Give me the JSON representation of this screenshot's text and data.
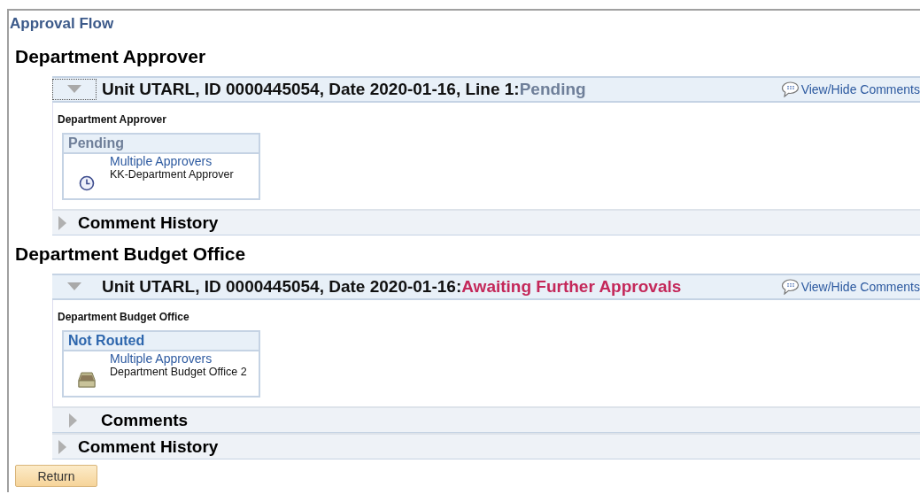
{
  "title": "Approval Flow",
  "sections": [
    {
      "heading": "Department Approver",
      "line": {
        "expanded": true,
        "focused": true,
        "label": "Unit UTARL, ID 0000445054, Date 2020-01-16, Line 1:",
        "status": "Pending",
        "color": "#6f7f99",
        "comments_link": "View/Hide Comments"
      },
      "step_label": "Department Approver",
      "approver": {
        "status": "Pending",
        "color": "#6f7f99",
        "link": "Multiple Approvers",
        "name": "KK-Department Approver",
        "kind": "clock"
      },
      "subpanels": [
        {
          "kind": "history",
          "label": "Comment History",
          "expanded": false
        }
      ]
    },
    {
      "heading": "Department Budget Office",
      "line": {
        "expanded": true,
        "focused": false,
        "label": "Unit UTARL, ID 0000445054, Date 2020-01-16:",
        "status": "Awaiting Further Approvals",
        "color": "#c4285a",
        "comments_link": "View/Hide Comments"
      },
      "step_label": "Department Budget Office",
      "approver": {
        "status": "Not Routed",
        "color": "#2d66ad",
        "link": "Multiple Approvers",
        "name": "Department Budget Office 2",
        "kind": "inbox"
      },
      "subpanels": [
        {
          "kind": "comments",
          "label": "Comments",
          "expanded": false
        },
        {
          "kind": "history",
          "label": "Comment History",
          "expanded": false
        }
      ]
    }
  ],
  "buttons": [
    "Return"
  ]
}
